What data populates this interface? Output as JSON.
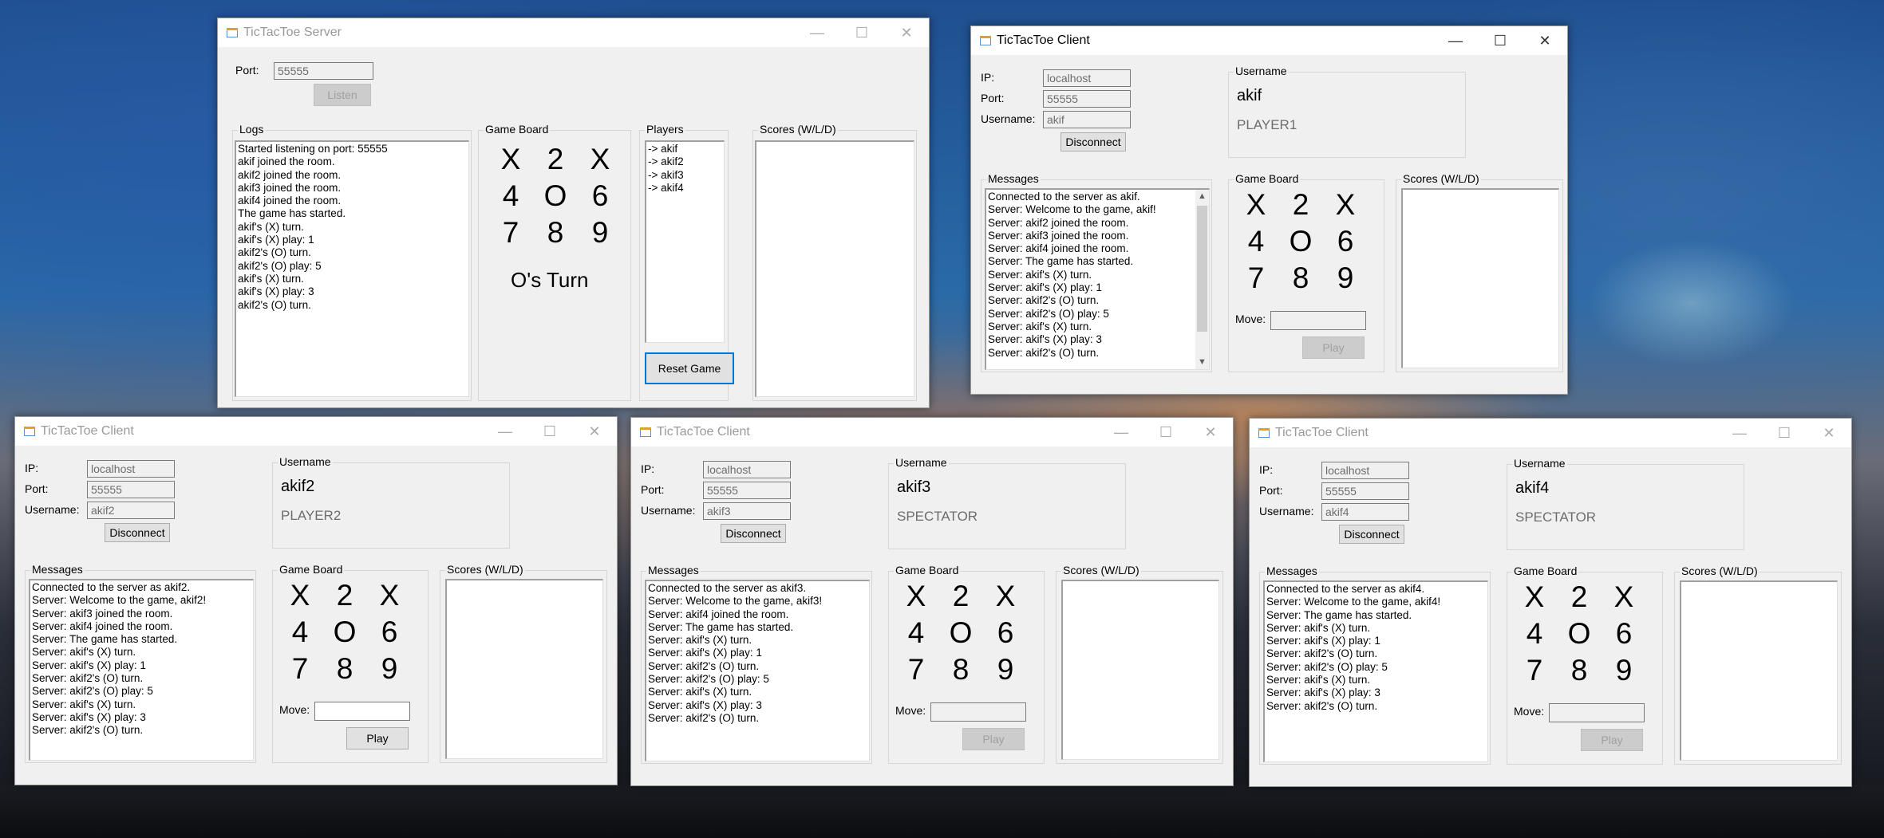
{
  "server": {
    "title": "TicTacToe Server",
    "port_label": "Port:",
    "port_value": "55555",
    "listen_button": "Listen",
    "logs_label": "Logs",
    "logs": [
      "Started listening on port: 55555",
      "akif joined the room.",
      "akif2 joined the room.",
      "akif3 joined the room.",
      "akif4 joined the room.",
      "The game has started.",
      "akif's (X) turn.",
      "akif's (X) play: 1",
      "akif2's (O) turn.",
      "akif2's (O) play: 5",
      "akif's (X) turn.",
      "akif's (X) play: 3",
      "akif2's (O) turn."
    ],
    "game_board_label": "Game Board",
    "board": [
      "X",
      "2",
      "X",
      "4",
      "O",
      "6",
      "7",
      "8",
      "9"
    ],
    "turn_text": "O's Turn",
    "players_label": "Players",
    "players": [
      "-> akif",
      "-> akif2",
      "-> akif3",
      "-> akif4"
    ],
    "reset_button": "Reset Game",
    "scores_label": "Scores (W/L/D)"
  },
  "common": {
    "client_title": "TicTacToe Client",
    "ip_label": "IP:",
    "port_label": "Port:",
    "username_label": "Username:",
    "username_group_label": "Username",
    "disconnect_button": "Disconnect",
    "messages_label": "Messages",
    "game_board_label": "Game Board",
    "scores_label": "Scores (W/L/D)",
    "move_label": "Move:",
    "play_button": "Play",
    "minimize_glyph": "—",
    "maximize_glyph": "☐",
    "close_glyph": "✕"
  },
  "clients": [
    {
      "ip": "localhost",
      "port": "55555",
      "username": "akif",
      "display_name": "akif",
      "role": "PLAYER1",
      "board": [
        "X",
        "2",
        "X",
        "4",
        "O",
        "6",
        "7",
        "8",
        "9"
      ],
      "messages": [
        "Connected to the server as akif.",
        "Server: Welcome to the game, akif!",
        "Server: akif2 joined the room.",
        "Server: akif3 joined the room.",
        "Server: akif4 joined the room.",
        "Server: The game has started.",
        "Server: akif's (X) turn.",
        "Server: akif's (X) play: 1",
        "Server: akif2's (O) turn.",
        "Server: akif2's (O) play: 5",
        "Server: akif's (X) turn.",
        "Server: akif's (X) play: 3",
        "Server: akif2's (O) turn."
      ]
    },
    {
      "ip": "localhost",
      "port": "55555",
      "username": "akif2",
      "display_name": "akif2",
      "role": "PLAYER2",
      "board": [
        "X",
        "2",
        "X",
        "4",
        "O",
        "6",
        "7",
        "8",
        "9"
      ],
      "messages": [
        "Connected to the server as akif2.",
        "Server: Welcome to the game, akif2!",
        "Server: akif3 joined the room.",
        "Server: akif4 joined the room.",
        "Server: The game has started.",
        "Server: akif's (X) turn.",
        "Server: akif's (X) play: 1",
        "Server: akif2's (O) turn.",
        "Server: akif2's (O) play: 5",
        "Server: akif's (X) turn.",
        "Server: akif's (X) play: 3",
        "Server: akif2's (O) turn."
      ]
    },
    {
      "ip": "localhost",
      "port": "55555",
      "username": "akif3",
      "display_name": "akif3",
      "role": "SPECTATOR",
      "board": [
        "X",
        "2",
        "X",
        "4",
        "O",
        "6",
        "7",
        "8",
        "9"
      ],
      "messages": [
        "Connected to the server as akif3.",
        "Server: Welcome to the game, akif3!",
        "Server: akif4 joined the room.",
        "Server: The game has started.",
        "Server: akif's (X) turn.",
        "Server: akif's (X) play: 1",
        "Server: akif2's (O) turn.",
        "Server: akif2's (O) play: 5",
        "Server: akif's (X) turn.",
        "Server: akif's (X) play: 3",
        "Server: akif2's (O) turn."
      ]
    },
    {
      "ip": "localhost",
      "port": "55555",
      "username": "akif4",
      "display_name": "akif4",
      "role": "SPECTATOR",
      "board": [
        "X",
        "2",
        "X",
        "4",
        "O",
        "6",
        "7",
        "8",
        "9"
      ],
      "messages": [
        "Connected to the server as akif4.",
        "Server: Welcome to the game, akif4!",
        "Server: The game has started.",
        "Server: akif's (X) turn.",
        "Server: akif's (X) play: 1",
        "Server: akif2's (O) turn.",
        "Server: akif2's (O) play: 5",
        "Server: akif's (X) turn.",
        "Server: akif's (X) play: 3",
        "Server: akif2's (O) turn."
      ]
    }
  ]
}
